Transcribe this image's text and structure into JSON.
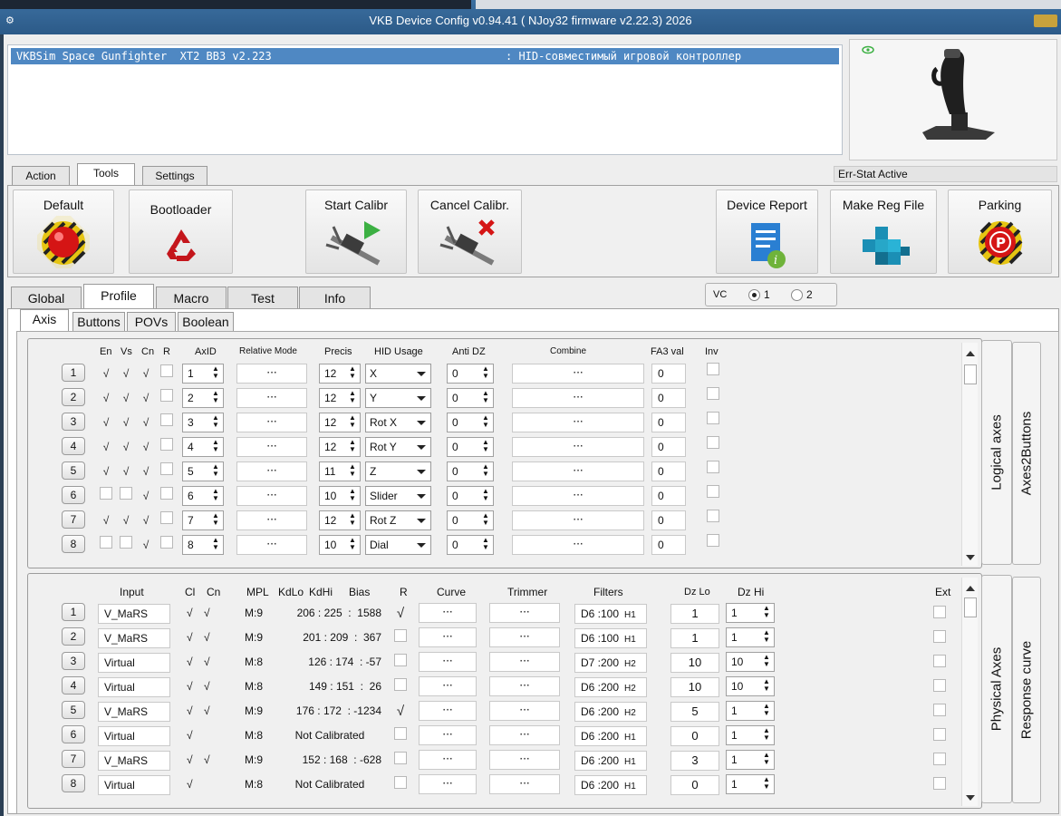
{
  "window": {
    "title": "VKB Device Config v0.94.41 ( NJoy32 firmware v2.22.3) 2026"
  },
  "device": {
    "name": "VKBSim Space Gunfighter  XT2 BB3 v2.223",
    "type": ": HID-совместимый игровой контроллер"
  },
  "status": "Err-Stat Active",
  "top_tabs": [
    "Action",
    "Tools",
    "Settings"
  ],
  "tools": {
    "default": "Default",
    "bootloader": "Bootloader",
    "start_calibr": "Start Calibr",
    "cancel_calibr": "Cancel Calibr.",
    "device_report": "Device Report",
    "make_reg_file": "Make Reg File",
    "parking": "Parking"
  },
  "profile_tabs": [
    "Global",
    "Profile",
    "Macro",
    "Test",
    "Info"
  ],
  "vc": {
    "label": "VC",
    "opt1": "1",
    "opt2": "2",
    "selected": "1"
  },
  "sub_tabs": [
    "Axis",
    "Buttons",
    "POVs",
    "Boolean"
  ],
  "side_tabs": {
    "logical": "Logical axes",
    "axes2buttons": "Axes2Buttons",
    "physical": "Physical Axes",
    "response": "Response curve"
  },
  "logical_headers": {
    "en": "En",
    "vs": "Vs",
    "cn": "Cn",
    "r": "R",
    "axid": "AxID",
    "relative": "Relative Mode",
    "precis": "Precis",
    "hid": "HID Usage",
    "antidz": "Anti DZ",
    "combine": "Combine",
    "fa3": "FA3 val",
    "inv": "Inv"
  },
  "logical_rows": [
    {
      "n": "1",
      "en": true,
      "vs": true,
      "cn": true,
      "axid": "1",
      "relative": "···",
      "precis": "12",
      "hid": "X",
      "antidz": "0",
      "combine": "···",
      "fa3": "0"
    },
    {
      "n": "2",
      "en": true,
      "vs": true,
      "cn": true,
      "axid": "2",
      "relative": "···",
      "precis": "12",
      "hid": "Y",
      "antidz": "0",
      "combine": "···",
      "fa3": "0"
    },
    {
      "n": "3",
      "en": true,
      "vs": true,
      "cn": true,
      "axid": "3",
      "relative": "···",
      "precis": "12",
      "hid": "Rot X",
      "antidz": "0",
      "combine": "···",
      "fa3": "0"
    },
    {
      "n": "4",
      "en": true,
      "vs": true,
      "cn": true,
      "axid": "4",
      "relative": "···",
      "precis": "12",
      "hid": "Rot Y",
      "antidz": "0",
      "combine": "···",
      "fa3": "0"
    },
    {
      "n": "5",
      "en": true,
      "vs": true,
      "cn": true,
      "axid": "5",
      "relative": "···",
      "precis": "11",
      "hid": "Z",
      "antidz": "0",
      "combine": "···",
      "fa3": "0"
    },
    {
      "n": "6",
      "en": false,
      "vs": false,
      "cn": true,
      "axid": "6",
      "relative": "···",
      "precis": "10",
      "hid": "Slider",
      "antidz": "0",
      "combine": "···",
      "fa3": "0"
    },
    {
      "n": "7",
      "en": true,
      "vs": true,
      "cn": true,
      "axid": "7",
      "relative": "···",
      "precis": "12",
      "hid": "Rot Z",
      "antidz": "0",
      "combine": "···",
      "fa3": "0"
    },
    {
      "n": "8",
      "en": false,
      "vs": false,
      "cn": true,
      "axid": "8",
      "relative": "···",
      "precis": "10",
      "hid": "Dial",
      "antidz": "0",
      "combine": "···",
      "fa3": "0"
    }
  ],
  "physical_headers": {
    "input": "Input",
    "cl": "Cl",
    "cn": "Cn",
    "mpl": "MPL",
    "kdlo": "KdLo",
    "kdhi": "KdHi",
    "bias": "Bias",
    "r": "R",
    "curve": "Curve",
    "trimmer": "Trimmer",
    "filters": "Filters",
    "dzlo": "Dz Lo",
    "dzhi": "Dz Hi",
    "ext": "Ext"
  },
  "physical_rows": [
    {
      "n": "1",
      "input": "V_MaRS",
      "cl": "√",
      "cn": "√",
      "mpl": "M:9",
      "cal": "206 : 225  :  1588",
      "r": true,
      "curve": "···",
      "trimmer": "···",
      "filter": "D6 :100",
      "fh": "H1",
      "dzlo": "1",
      "dzhi": "1"
    },
    {
      "n": "2",
      "input": "V_MaRS",
      "cl": "√",
      "cn": "√",
      "mpl": "M:9",
      "cal": "201 : 209  :  367",
      "r": false,
      "curve": "···",
      "trimmer": "···",
      "filter": "D6 :100",
      "fh": "H1",
      "dzlo": "1",
      "dzhi": "1"
    },
    {
      "n": "3",
      "input": "Virtual",
      "cl": "√",
      "cn": "√",
      "mpl": "M:8",
      "cal": "126 : 174  : -57",
      "r": false,
      "curve": "···",
      "trimmer": "···",
      "filter": "D7 :200",
      "fh": "H2",
      "dzlo": "10",
      "dzhi": "10"
    },
    {
      "n": "4",
      "input": "Virtual",
      "cl": "√",
      "cn": "√",
      "mpl": "M:8",
      "cal": "149 : 151  :  26",
      "r": false,
      "curve": "···",
      "trimmer": "···",
      "filter": "D6 :200",
      "fh": "H2",
      "dzlo": "10",
      "dzhi": "10"
    },
    {
      "n": "5",
      "input": "V_MaRS",
      "cl": "√",
      "cn": "√",
      "mpl": "M:9",
      "cal": "176 : 172  : -1234",
      "r": true,
      "curve": "···",
      "trimmer": "···",
      "filter": "D6 :200",
      "fh": "H2",
      "dzlo": "5",
      "dzhi": "1"
    },
    {
      "n": "6",
      "input": "Virtual",
      "cl": "√",
      "cn": "",
      "mpl": "M:8",
      "cal": "Not Calibrated",
      "r": false,
      "curve": "···",
      "trimmer": "···",
      "filter": "D6 :200",
      "fh": "H1",
      "dzlo": "0",
      "dzhi": "1"
    },
    {
      "n": "7",
      "input": "V_MaRS",
      "cl": "√",
      "cn": "√",
      "mpl": "M:9",
      "cal": "152 : 168  : -628",
      "r": false,
      "curve": "···",
      "trimmer": "···",
      "filter": "D6 :200",
      "fh": "H1",
      "dzlo": "3",
      "dzhi": "1"
    },
    {
      "n": "8",
      "input": "Virtual",
      "cl": "√",
      "cn": "",
      "mpl": "M:8",
      "cal": "Not Calibrated",
      "r": false,
      "curve": "···",
      "trimmer": "···",
      "filter": "D6 :200",
      "fh": "H1",
      "dzlo": "0",
      "dzhi": "1"
    }
  ],
  "colors": {
    "accent": "#4f88c3",
    "titlebar": "#2c5a88"
  }
}
